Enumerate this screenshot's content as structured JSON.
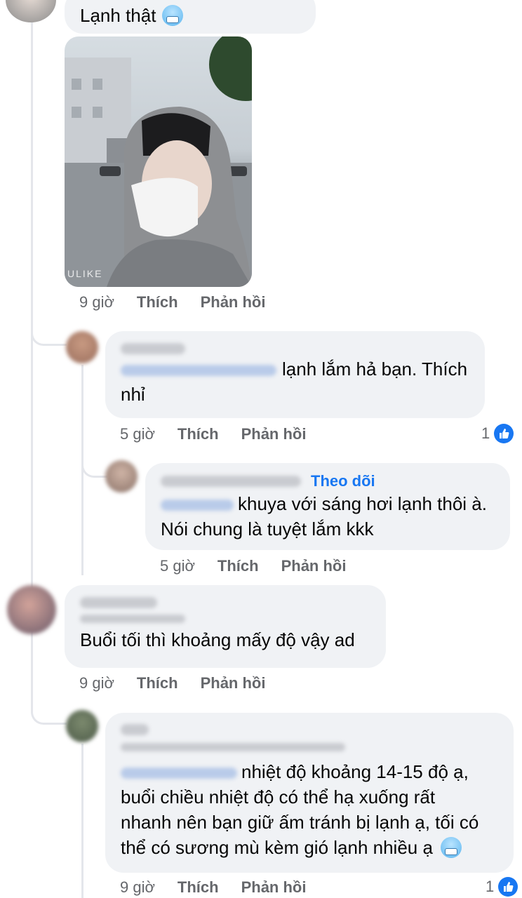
{
  "comments": [
    {
      "text": "Lạnh thật",
      "time": "9 giờ",
      "like": "Thích",
      "reply": "Phản hồi",
      "icon": "cold-face-emoji"
    },
    {
      "text": "lạnh lắm hả bạn. Thích nhỉ",
      "time": "5 giờ",
      "like": "Thích",
      "reply": "Phản hồi",
      "reactions": "1"
    },
    {
      "follow": "Theo dõi",
      "text_line1": "khuya với sáng hơi lạnh thôi à.",
      "text_line2": "Nói chung là tuyệt lắm kkk",
      "time": "5 giờ",
      "like": "Thích",
      "reply": "Phản hồi"
    },
    {
      "text": "Buổi tối thì khoảng mấy độ vậy ad",
      "time": "9 giờ",
      "like": "Thích",
      "reply": "Phản hồi"
    },
    {
      "text_line1": "nhiệt độ khoảng 14-15 độ ạ,",
      "text_line2": "buổi chiều nhiệt độ có thể hạ xuống rất",
      "text_line3": "nhanh nên bạn giữ ấm tránh bị lạnh ạ, tối có",
      "text_line4": "thể có sương mù kèm gió lạnh nhiều ạ",
      "time": "9 giờ",
      "like": "Thích",
      "reply": "Phản hồi",
      "reactions": "1"
    }
  ],
  "photo": {
    "watermark": "ULIKE"
  },
  "colors": {
    "accent": "#1877f2",
    "bubble": "#f0f2f5",
    "meta": "#65676b"
  }
}
